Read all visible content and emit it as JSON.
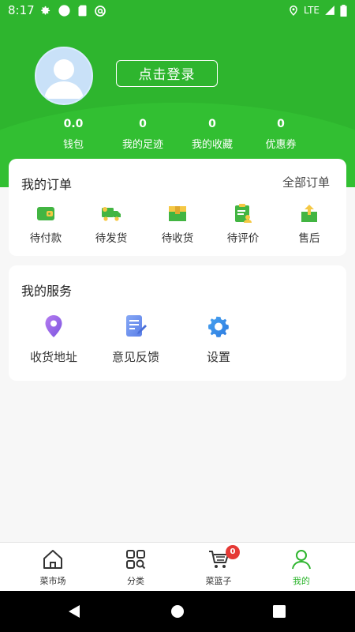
{
  "status_bar": {
    "time": "8:17",
    "network": "LTE",
    "icons_left": [
      "gear-icon",
      "circle-icon",
      "sim-card-icon",
      "at-sign-icon"
    ],
    "icons_right": [
      "location-icon",
      "signal-icon",
      "battery-icon"
    ]
  },
  "header": {
    "login_button": "点击登录",
    "avatar_icon": "default-avatar-icon"
  },
  "stats": [
    {
      "value": "0.0",
      "label": "钱包"
    },
    {
      "value": "0",
      "label": "我的足迹"
    },
    {
      "value": "0",
      "label": "我的收藏"
    },
    {
      "value": "0",
      "label": "优惠券"
    }
  ],
  "orders": {
    "title": "我的订单",
    "all_link": "全部订单",
    "items": [
      {
        "label": "待付款",
        "icon": "wallet-icon"
      },
      {
        "label": "待发货",
        "icon": "truck-icon"
      },
      {
        "label": "待收货",
        "icon": "package-icon"
      },
      {
        "label": "待评价",
        "icon": "clipboard-review-icon"
      },
      {
        "label": "售后",
        "icon": "return-box-icon"
      }
    ]
  },
  "services": {
    "title": "我的服务",
    "items": [
      {
        "label": "收货地址",
        "icon": "location-pin-icon"
      },
      {
        "label": "意见反馈",
        "icon": "feedback-document-icon"
      },
      {
        "label": "设置",
        "icon": "gear-icon"
      }
    ]
  },
  "tabbar": {
    "tabs": [
      {
        "label": "菜市场",
        "icon": "home-icon"
      },
      {
        "label": "分类",
        "icon": "category-icon"
      },
      {
        "label": "菜篮子",
        "icon": "cart-icon"
      },
      {
        "label": "我的",
        "icon": "user-icon",
        "active": true
      }
    ],
    "cart_badge": "0"
  },
  "colors": {
    "primary": "#2eb52e",
    "badge": "#e53935",
    "background": "#f7f7f7"
  },
  "nav_bar": {
    "buttons": [
      "back-icon",
      "home-icon",
      "recents-icon"
    ]
  }
}
